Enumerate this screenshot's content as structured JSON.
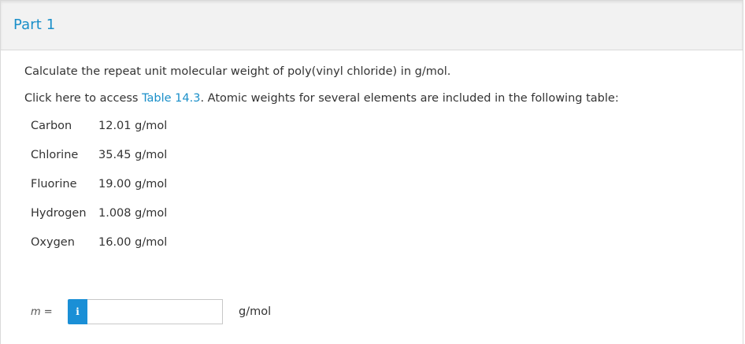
{
  "part": {
    "title": "Part 1"
  },
  "question": {
    "text": "Calculate the repeat unit molecular weight of poly(vinyl chloride) in g/mol.",
    "access_prefix": "Click here to access ",
    "access_link": "Table 14.3",
    "access_suffix": ". Atomic weights for several elements are included in the following table:"
  },
  "atomic_weights": [
    {
      "element": "Carbon",
      "weight": "12.01 g/mol"
    },
    {
      "element": "Chlorine",
      "weight": "35.45 g/mol"
    },
    {
      "element": "Fluorine",
      "weight": "19.00 g/mol"
    },
    {
      "element": "Hydrogen",
      "weight": "1.008 g/mol"
    },
    {
      "element": "Oxygen",
      "weight": "16.00 g/mol"
    }
  ],
  "answer": {
    "variable": "m",
    "equals": " =",
    "info_icon": "i",
    "value": "",
    "placeholder": "",
    "unit": "g/mol"
  },
  "colors": {
    "accent": "#1a8fc9",
    "info_button": "#1a8fd6",
    "header_bg": "#f2f2f2"
  }
}
